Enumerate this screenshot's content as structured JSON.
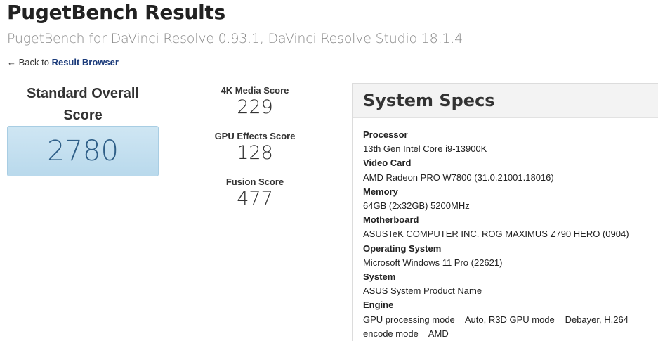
{
  "header": {
    "title": "PugetBench Results",
    "subtitle": "PugetBench for DaVinci Resolve 0.93.1, DaVinci Resolve Studio 18.1.4"
  },
  "back": {
    "prefix": "← Back to ",
    "link_label": "Result Browser"
  },
  "overall": {
    "label": "Standard Overall Score",
    "value": "2780"
  },
  "sub_scores": [
    {
      "label": "4K Media Score",
      "value": "229"
    },
    {
      "label": "GPU Effects Score",
      "value": "128"
    },
    {
      "label": "Fusion Score",
      "value": "477"
    }
  ],
  "specs": {
    "title": "System Specs",
    "items": [
      {
        "label": "Processor",
        "value": "13th Gen Intel Core i9-13900K"
      },
      {
        "label": "Video Card",
        "value": "AMD Radeon PRO W7800 (31.0.21001.18016)"
      },
      {
        "label": "Memory",
        "value": "64GB (2x32GB) 5200MHz"
      },
      {
        "label": "Motherboard",
        "value": "ASUSTeK COMPUTER INC. ROG MAXIMUS Z790 HERO (0904)"
      },
      {
        "label": "Operating System",
        "value": "Microsoft Windows 11 Pro (22621)"
      },
      {
        "label": "System",
        "value": "ASUS System Product Name"
      },
      {
        "label": "Engine",
        "value": "GPU processing mode = Auto, R3D GPU mode = Debayer, H.264 encode mode = AMD"
      }
    ]
  },
  "colors": {
    "score_box_bg": "#c4dff0",
    "score_value": "#2f5f88",
    "link": "#1a3a7a"
  }
}
